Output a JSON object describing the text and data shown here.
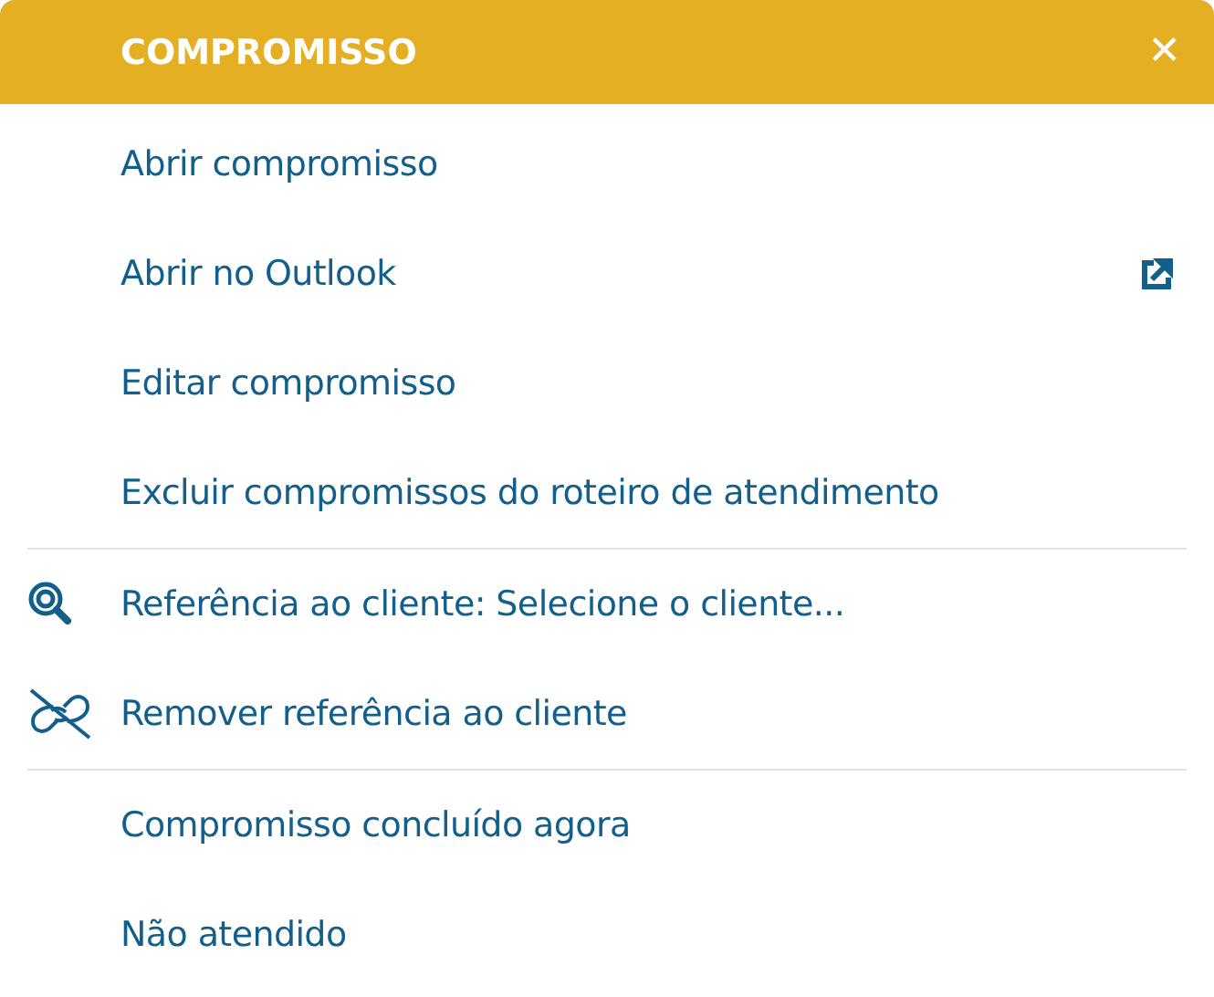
{
  "header": {
    "title": "COMPROMISSO",
    "close": "✕"
  },
  "sections": [
    [
      {
        "label": "Abrir compromisso",
        "kind": "plain"
      },
      {
        "label": "Abrir no Outlook",
        "kind": "external"
      },
      {
        "label": "Editar compromisso",
        "kind": "plain"
      },
      {
        "label": "Excluir compromissos do roteiro de atendimento",
        "kind": "plain"
      }
    ],
    [
      {
        "label": "Referência ao cliente: Selecione o cliente...",
        "kind": "search"
      },
      {
        "label": "Remover referência ao cliente",
        "kind": "unlink"
      }
    ],
    [
      {
        "label": "Compromisso concluído agora",
        "kind": "plain"
      },
      {
        "label": "Não atendido",
        "kind": "plain"
      }
    ]
  ]
}
